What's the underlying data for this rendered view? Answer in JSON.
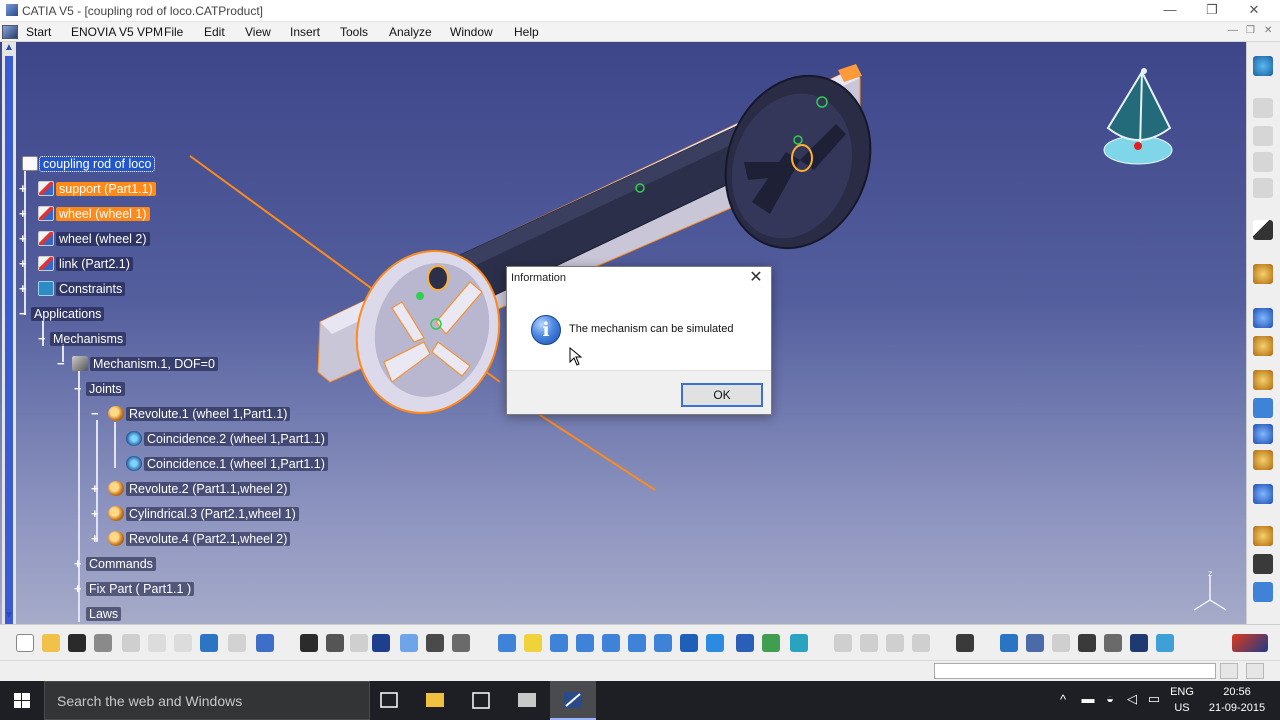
{
  "window": {
    "title": "CATIA V5 - [coupling rod of loco.CATProduct]",
    "controls": {
      "minimize": "—",
      "restore": "❐",
      "close": "✕"
    }
  },
  "menu": {
    "items": [
      "Start",
      "ENOVIA V5 VPM",
      "File",
      "Edit",
      "View",
      "Insert",
      "Tools",
      "Analyze",
      "Window",
      "Help"
    ],
    "mdi_controls": [
      "—",
      "❐",
      "✕"
    ]
  },
  "tree": {
    "root": "coupling rod of loco",
    "parts": [
      "support (Part1.1)",
      "wheel (wheel 1)",
      "wheel (wheel 2)",
      "link (Part2.1)"
    ],
    "constraints": "Constraints",
    "applications": "Applications",
    "mechanisms": "Mechanisms",
    "mechanism": "Mechanism.1, DOF=0",
    "joints": "Joints",
    "revolute1": "Revolute.1 (wheel 1,Part1.1)",
    "coincidence2": "Coincidence.2 (wheel 1,Part1.1)",
    "coincidence1": "Coincidence.1 (wheel 1,Part1.1)",
    "revolute2": "Revolute.2 (Part1.1,wheel 2)",
    "cylindrical3": "Cylindrical.3 (Part2.1,wheel 1)",
    "revolute4": "Revolute.4 (Part2.1,wheel 2)",
    "commands": "Commands",
    "fixpart": "Fix Part ( Part1.1 )",
    "laws": "Laws"
  },
  "dialog": {
    "title": "Information",
    "message": "The mechanism can be simulated",
    "ok": "OK",
    "close": "✕",
    "icon": "info-icon"
  },
  "taskbar": {
    "search_placeholder": "Search the web and Windows",
    "lang_top": "ENG",
    "lang_bottom": "US",
    "time": "20:56",
    "date": "21-09-2015"
  },
  "colors": {
    "highlight": "#ff8a1a",
    "selection": "#2356c8",
    "viewport_top": "#3d4689",
    "viewport_bottom": "#a6abc9"
  }
}
